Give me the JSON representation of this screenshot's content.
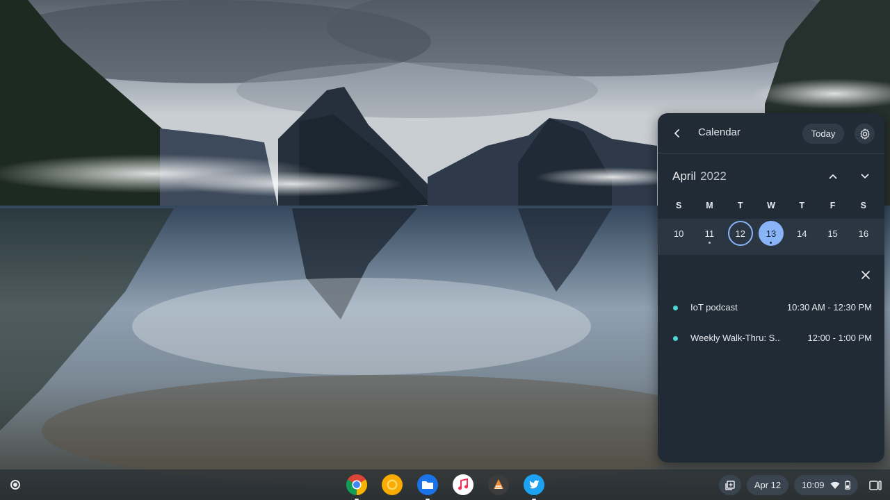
{
  "calendar": {
    "title": "Calendar",
    "today_label": "Today",
    "month": "April",
    "year": "2022",
    "weekdays": [
      "S",
      "M",
      "T",
      "W",
      "T",
      "F",
      "S"
    ],
    "days": [
      {
        "num": "10",
        "dot": false,
        "state": ""
      },
      {
        "num": "11",
        "dot": true,
        "state": ""
      },
      {
        "num": "12",
        "dot": false,
        "state": "today"
      },
      {
        "num": "13",
        "dot": true,
        "state": "selected"
      },
      {
        "num": "14",
        "dot": false,
        "state": ""
      },
      {
        "num": "15",
        "dot": false,
        "state": ""
      },
      {
        "num": "16",
        "dot": false,
        "state": ""
      }
    ],
    "events": [
      {
        "title": "IoT podcast",
        "time": "10:30 AM - 12:30 PM"
      },
      {
        "title": "Weekly Walk-Thru: S...",
        "time": "12:00 - 1:00 PM"
      }
    ]
  },
  "shelf": {
    "apps": [
      "chrome-icon",
      "chrome-canary-icon",
      "files-icon",
      "music-icon",
      "sketch-app-icon",
      "twitter-icon"
    ],
    "date": "Apr 12",
    "time": "10:09"
  },
  "colors": {
    "panel_bg": "#202b36",
    "accent": "#8ab4f8",
    "event_dot": "#4fd6d8"
  }
}
